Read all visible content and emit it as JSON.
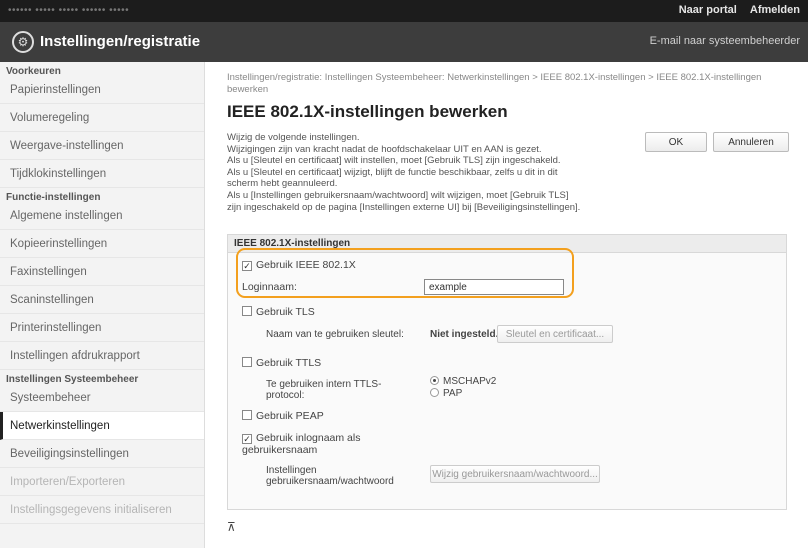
{
  "topbar": {
    "device_name": "••••••  ••••• ••••• •••••• •••••",
    "portal_link": "Naar portal",
    "logout_link": "Afmelden"
  },
  "header": {
    "title": "Instellingen/registratie",
    "email_link": "E-mail naar systeembeheerder"
  },
  "sidebar": {
    "sections": [
      {
        "heading": "Voorkeuren",
        "items": [
          "Papierinstellingen",
          "Volumeregeling",
          "Weergave-instellingen",
          "Tijdklokinstellingen"
        ]
      },
      {
        "heading": "Functie-instellingen",
        "items": [
          "Algemene instellingen",
          "Kopieerinstellingen",
          "Faxinstellingen",
          "Scaninstellingen",
          "Printerinstellingen",
          "Instellingen afdrukrapport"
        ]
      },
      {
        "heading": "Instellingen Systeembeheer",
        "items": [
          "Systeembeheer",
          "Netwerkinstellingen",
          "Beveiligingsinstellingen",
          "Importeren/Exporteren",
          "Instellingsgegevens initialiseren"
        ]
      }
    ],
    "active_item": "Netwerkinstellingen"
  },
  "main": {
    "breadcrumb": "Instellingen/registratie: Instellingen Systeembeheer: Netwerkinstellingen > IEEE 802.1X-instellingen > IEEE 802.1X-instellingen bewerken",
    "page_title": "IEEE 802.1X-instellingen bewerken",
    "notes": [
      "Wijzig de volgende instellingen.",
      "Wijzigingen zijn van kracht nadat de hoofdschakelaar UIT en AAN is gezet.",
      "Als u [Sleutel en certificaat] wilt instellen, moet [Gebruik TLS] zijn ingeschakeld.",
      "Als u [Sleutel en certificaat] wijzigt, blijft de functie beschikbaar, zelfs u dit in dit",
      "scherm hebt geannuleerd.",
      "Als u [Instellingen gebruikersnaam/wachtwoord] wilt wijzigen, moet [Gebruik TLS]",
      "zijn ingeschakeld op de pagina [Instellingen externe UI] bij [Beveiligingsinstellingen]."
    ],
    "ok_label": "OK",
    "cancel_label": "Annuleren",
    "panel": {
      "heading": "IEEE 802.1X-instellingen",
      "use_ieee_label": "Gebruik IEEE 802.1X",
      "use_ieee_checked": true,
      "login_label": "Loginnaam:",
      "login_value": "example",
      "use_tls_label": "Gebruik TLS",
      "use_tls_checked": false,
      "key_name_label": "Naam van te gebruiken sleutel:",
      "key_name_value": "Niet ingesteld.",
      "key_cert_button": "Sleutel en certificaat...",
      "use_ttls_label": "Gebruik TTLS",
      "use_ttls_checked": false,
      "ttls_protocol_label": "Te gebruiken intern TTLS-protocol:",
      "ttls_options": [
        "MSCHAPv2",
        "PAP"
      ],
      "ttls_selected": "MSCHAPv2",
      "use_peap_label": "Gebruik PEAP",
      "use_peap_checked": false,
      "use_login_as_user_label": "Gebruik inlognaam als gebruikersnaam",
      "use_login_as_user_checked": true,
      "user_pass_settings_label": "Instellingen gebruikersnaam/wachtwoord",
      "change_user_pass_button": "Wijzig gebruikersnaam/wachtwoord..."
    },
    "footer_icon": "top-arrow-icon"
  },
  "colors": {
    "highlight": "#f3a01e",
    "header_bg": "#3d3d3d",
    "topbar_bg": "#1c1c1c"
  }
}
